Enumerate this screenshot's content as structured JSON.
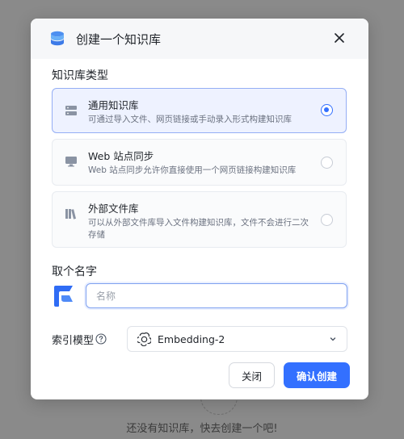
{
  "backdrop": {
    "empty_text": "还没有知识库，快去创建一个吧!"
  },
  "dialog": {
    "title": "创建一个知识库",
    "type_section_label": "知识库类型",
    "types": [
      {
        "name": "通用知识库",
        "description": "可通过导入文件、网页链接或手动录入形式构建知识库",
        "icon": "server-icon",
        "selected": true
      },
      {
        "name": "Web 站点同步",
        "description": "Web 站点同步允许你直接使用一个网页链接构建知识库",
        "icon": "monitor-icon",
        "selected": false
      },
      {
        "name": "外部文件库",
        "description": "可以从外部文件库导入文件构建知识库，文件不会进行二次存储",
        "icon": "books-icon",
        "selected": false
      }
    ],
    "name_label": "取个名字",
    "name_placeholder": "名称",
    "name_value": "",
    "model_label": "索引模型",
    "model_value": "Embedding-2",
    "buttons": {
      "close": "关闭",
      "confirm": "确认创建"
    }
  },
  "colors": {
    "primary": "#3370ff",
    "overlay": "#8a8a8a",
    "card_selected_bg": "#eef2ff"
  }
}
